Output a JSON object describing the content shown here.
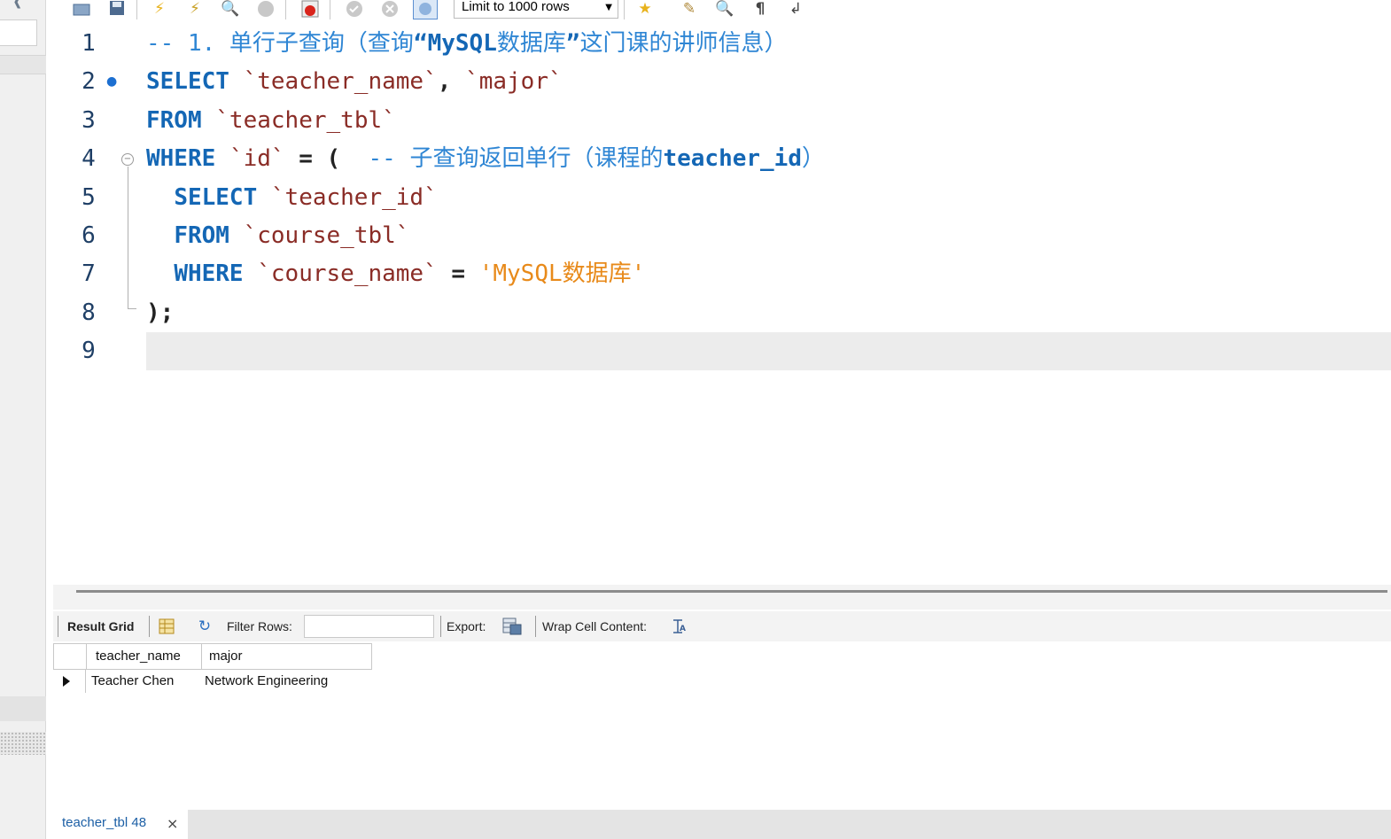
{
  "toolbar": {
    "icons": [
      "open-file-icon",
      "save-icon",
      "execute-icon",
      "execute-current-icon",
      "explain-icon",
      "stop-icon",
      "toggle-error-icon",
      "commit-icon",
      "rollback-icon",
      "autocommit-icon",
      "add-snippet-icon",
      "beautify-icon",
      "find-icon",
      "invisible-chars-icon",
      "wrap-icon"
    ],
    "limit_label": "Limit to 1000 rows"
  },
  "editor": {
    "line_numbers": [
      "1",
      "2",
      "3",
      "4",
      "5",
      "6",
      "7",
      "8",
      "9"
    ],
    "lines": [
      {
        "indent": "",
        "tokens": [
          {
            "t": "cm",
            "v": "-- 1. 单行子查询（查询"
          },
          {
            "t": "cm-b",
            "v": "“MySQL"
          },
          {
            "t": "cm",
            "v": "数据库"
          },
          {
            "t": "cm-b",
            "v": "”"
          },
          {
            "t": "cm",
            "v": "这门课的讲师信息）"
          }
        ]
      },
      {
        "indent": "",
        "tokens": [
          {
            "t": "kw",
            "v": "SELECT"
          },
          {
            "t": "op",
            "v": " "
          },
          {
            "t": "id",
            "v": "`teacher_name`"
          },
          {
            "t": "op",
            "v": ", "
          },
          {
            "t": "id",
            "v": "`major`"
          }
        ]
      },
      {
        "indent": "",
        "tokens": [
          {
            "t": "kw",
            "v": "FROM"
          },
          {
            "t": "op",
            "v": " "
          },
          {
            "t": "id",
            "v": "`teacher_tbl`"
          }
        ]
      },
      {
        "indent": "",
        "tokens": [
          {
            "t": "kw",
            "v": "WHERE"
          },
          {
            "t": "op",
            "v": " "
          },
          {
            "t": "id",
            "v": "`id`"
          },
          {
            "t": "op",
            "v": " = (  "
          },
          {
            "t": "cm",
            "v": "-- 子查询返回单行（课程的"
          },
          {
            "t": "cm-b",
            "v": "teacher_id"
          },
          {
            "t": "cm",
            "v": "）"
          }
        ]
      },
      {
        "indent": "  ",
        "tokens": [
          {
            "t": "kw",
            "v": "SELECT"
          },
          {
            "t": "op",
            "v": " "
          },
          {
            "t": "id",
            "v": "`teacher_id`"
          }
        ]
      },
      {
        "indent": "  ",
        "tokens": [
          {
            "t": "kw",
            "v": "FROM"
          },
          {
            "t": "op",
            "v": " "
          },
          {
            "t": "id",
            "v": "`course_tbl`"
          }
        ]
      },
      {
        "indent": "  ",
        "tokens": [
          {
            "t": "kw",
            "v": "WHERE"
          },
          {
            "t": "op",
            "v": " "
          },
          {
            "t": "id",
            "v": "`course_name`"
          },
          {
            "t": "op",
            "v": " = "
          },
          {
            "t": "str",
            "v": "'MySQL数据库'"
          }
        ]
      },
      {
        "indent": "",
        "tokens": [
          {
            "t": "op",
            "v": ");"
          }
        ]
      },
      {
        "indent": "",
        "tokens": []
      }
    ]
  },
  "result_toolbar": {
    "result_grid_label": "Result Grid",
    "filter_label": "Filter Rows:",
    "filter_value": "",
    "export_label": "Export:",
    "wrap_label": "Wrap Cell Content:"
  },
  "grid": {
    "columns": [
      "teacher_name",
      "major"
    ],
    "rows": [
      [
        "Teacher Chen",
        "Network Engineering"
      ]
    ]
  },
  "tabs": [
    {
      "label": "teacher_tbl 48",
      "close": "×"
    }
  ]
}
